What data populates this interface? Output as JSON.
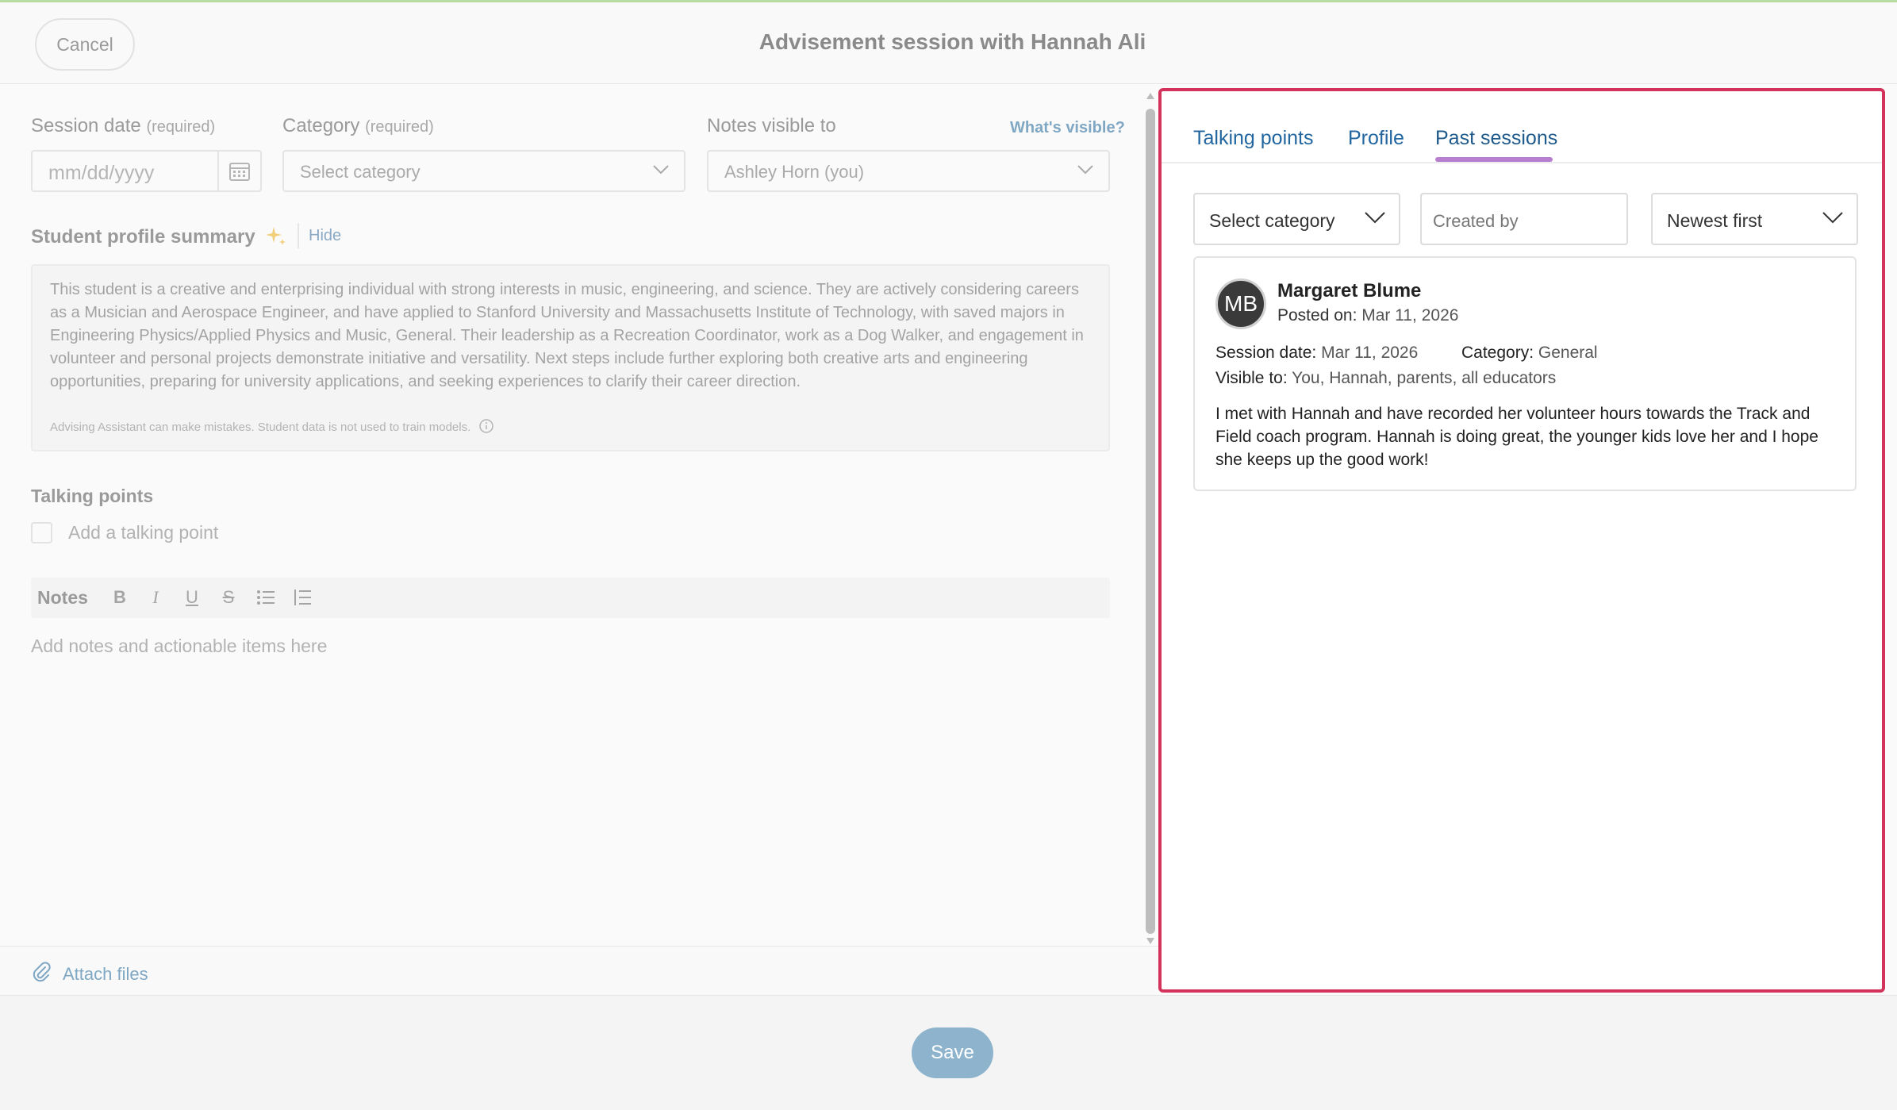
{
  "header": {
    "cancel_label": "Cancel",
    "title": "Advisement session with Hannah Ali"
  },
  "form": {
    "session_date_label": "Session date",
    "session_date_req": "(required)",
    "session_date_placeholder": "mm/dd/yyyy",
    "category_label": "Category",
    "category_req": "(required)",
    "category_value": "Select category",
    "visible_label": "Notes visible to",
    "whats_visible": "What's visible?",
    "visible_value": "Ashley Horn (you)",
    "summary_title": "Student profile summary",
    "hide_label": "Hide",
    "summary_text": "This student is a creative and enterprising individual with strong interests in music, engineering, and science. They are actively considering careers as a Musician and Aerospace Engineer, and have applied to Stanford University and Massachusetts Institute of Technology, with saved majors in Engineering Physics/Applied Physics and Music, General. Their leadership as a Recreation Coordinator, work as a Dog Walker, and engagement in volunteer and personal projects demonstrate initiative and versatility. Next steps include further exploring both creative arts and engineering opportunities, preparing for university applications, and seeking experiences to clarify their career direction.",
    "disclaimer": "Advising Assistant can make mistakes. Student data is not used to train models.",
    "talking_points_title": "Talking points",
    "add_talking_point": "Add a talking point",
    "notes_label": "Notes",
    "notes_placeholder": "Add notes and actionable items here",
    "attach_label": "Attach files"
  },
  "toolbar": {
    "bold": "B",
    "italic": "I",
    "underline": "U",
    "strike": "S"
  },
  "footer": {
    "save_label": "Save"
  },
  "panel": {
    "tabs": [
      "Talking points",
      "Profile",
      "Past sessions"
    ],
    "active_tab": "Past sessions",
    "filters": {
      "category": "Select category",
      "created_by_placeholder": "Created by",
      "sort": "Newest first"
    },
    "session": {
      "initials": "MB",
      "author": "Margaret Blume",
      "posted_label": "Posted on:",
      "posted_value": "Mar 11, 2026",
      "date_label": "Session date:",
      "date_value": "Mar 11, 2026",
      "category_label": "Category:",
      "category_value": "General",
      "visible_label": "Visible to:",
      "visible_value": "You, Hannah, parents, all educators",
      "body": "I met with Hannah and have recorded her volunteer hours towards the Track and Field coach program. Hannah is doing great, the younger kids love her and I hope she keeps up the good work!"
    }
  },
  "colors": {
    "accent_blue": "#2266a0",
    "tab_underline": "#b87fd0",
    "highlight_border": "#d3325a",
    "save_button": "#8db3cd"
  }
}
